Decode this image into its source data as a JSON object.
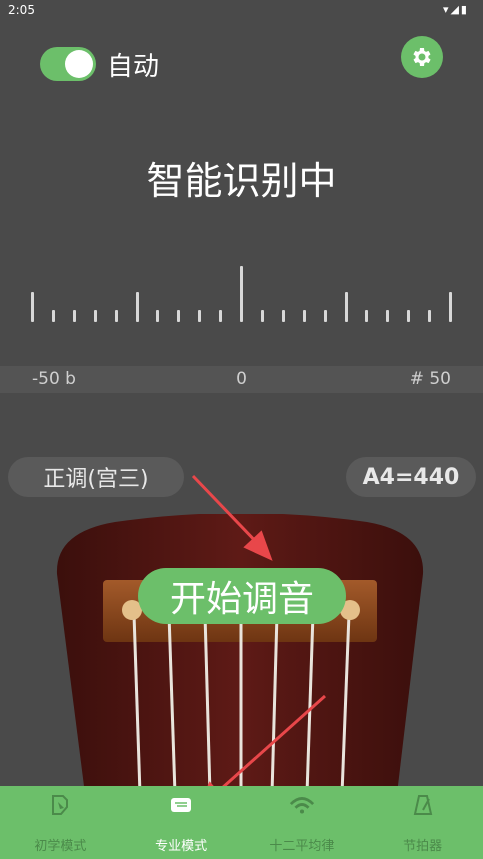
{
  "status_bar": {
    "time": "2:05",
    "icons": "▾◢▮"
  },
  "header": {
    "auto_label": "自动",
    "auto_enabled": true
  },
  "title": "智能识别中",
  "scale": {
    "left": "-50 b",
    "center": "0",
    "right": "# 50"
  },
  "tuning": {
    "mode": "正调(宫三)",
    "a4": "A4=440"
  },
  "start_button": "开始调音",
  "nav": {
    "items": [
      {
        "label": "初学模式",
        "icon": "beginner-icon",
        "active": false
      },
      {
        "label": "专业模式",
        "icon": "pro-mode-icon",
        "active": true
      },
      {
        "label": "十二平均律",
        "icon": "equal-temperament-icon",
        "active": false
      },
      {
        "label": "节拍器",
        "icon": "metronome-icon",
        "active": false
      }
    ]
  },
  "colors": {
    "accent": "#6cbf6a",
    "background": "#4a4a4a",
    "nav_inactive": "#4b8a4a",
    "arrow": "#e8474a",
    "guitar": "#5e1a16"
  }
}
